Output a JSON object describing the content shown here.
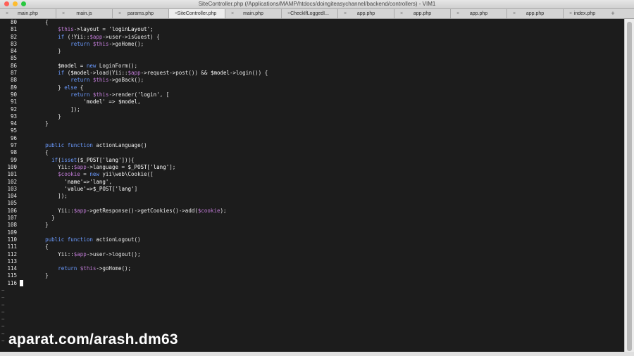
{
  "window": {
    "title": "SiteController.php (/Applications/MAMP/htdocs/doingiteasychannel/backend/controllers) - VIM1",
    "traffic_lights": [
      {
        "name": "close",
        "color": "#ff5f57"
      },
      {
        "name": "minimize",
        "color": "#febc2e"
      },
      {
        "name": "zoom",
        "color": "#28c840"
      }
    ]
  },
  "tabs": [
    {
      "label": "main.php",
      "active": false
    },
    {
      "label": "main.js",
      "active": false
    },
    {
      "label": "params.php",
      "active": false
    },
    {
      "label": "SiteController.php",
      "active": true
    },
    {
      "label": "main.php",
      "active": false
    },
    {
      "label": "CheckIfLoggedI...",
      "active": false
    },
    {
      "label": "app.php",
      "active": false
    },
    {
      "label": "app.php",
      "active": false
    },
    {
      "label": "app.php",
      "active": false
    },
    {
      "label": "app.php",
      "active": false
    },
    {
      "label": "index.php",
      "active": false
    }
  ],
  "tab_close_glyph": "×",
  "new_tab_glyph": "+",
  "editor": {
    "lines": [
      {
        "n": "80",
        "t": "        {"
      },
      {
        "n": "81",
        "t": "            $this->layout = 'loginLayout';"
      },
      {
        "n": "82",
        "t": "            if (!Yii::$app->user->isGuest) {"
      },
      {
        "n": "83",
        "t": "                return $this->goHome();"
      },
      {
        "n": "84",
        "t": "            }"
      },
      {
        "n": "85",
        "t": ""
      },
      {
        "n": "86",
        "t": "            $model = new LoginForm();"
      },
      {
        "n": "87",
        "t": "            if ($model->load(Yii::$app->request->post()) && $model->login()) {"
      },
      {
        "n": "88",
        "t": "                return $this->goBack();"
      },
      {
        "n": "89",
        "t": "            } else {"
      },
      {
        "n": "90",
        "t": "                return $this->render('login', ["
      },
      {
        "n": "91",
        "t": "                    'model' => $model,"
      },
      {
        "n": "92",
        "t": "                ]);"
      },
      {
        "n": "93",
        "t": "            }"
      },
      {
        "n": "94",
        "t": "        }"
      },
      {
        "n": "95",
        "t": ""
      },
      {
        "n": "96",
        "t": ""
      },
      {
        "n": "97",
        "t": "        public function actionLanguage()"
      },
      {
        "n": "98",
        "t": "        {"
      },
      {
        "n": "99",
        "t": "          if(isset($_POST['lang'])){"
      },
      {
        "n": "100",
        "t": "            Yii::$app->language = $_POST['lang'];"
      },
      {
        "n": "101",
        "t": "            $cookie = new yii\\web\\Cookie(["
      },
      {
        "n": "102",
        "t": "              'name'=>'lang',"
      },
      {
        "n": "103",
        "t": "              'value'=>$_POST['lang']"
      },
      {
        "n": "104",
        "t": "            ]);"
      },
      {
        "n": "105",
        "t": ""
      },
      {
        "n": "106",
        "t": "            Yii::$app->getResponse()->getCookies()->add($cookie);"
      },
      {
        "n": "107",
        "t": "          }"
      },
      {
        "n": "108",
        "t": "        }"
      },
      {
        "n": "109",
        "t": ""
      },
      {
        "n": "110",
        "t": "        public function actionLogout()"
      },
      {
        "n": "111",
        "t": "        {"
      },
      {
        "n": "112",
        "t": "            Yii::$app->user->logout();"
      },
      {
        "n": "113",
        "t": ""
      },
      {
        "n": "114",
        "t": "            return $this->goHome();"
      },
      {
        "n": "115",
        "t": "        }"
      },
      {
        "n": "116",
        "t": ""
      }
    ],
    "cursor_line": "116",
    "empty_line_marker": "~",
    "empty_line_count": 8
  },
  "watermark": "aparat.com/arash.dm63",
  "colors": {
    "background": "#1c1c1c",
    "text": "#eaeaea",
    "keyword": "#6b9bff",
    "this_variable": "#c07bd6",
    "line_number": "#e8e8e8"
  }
}
